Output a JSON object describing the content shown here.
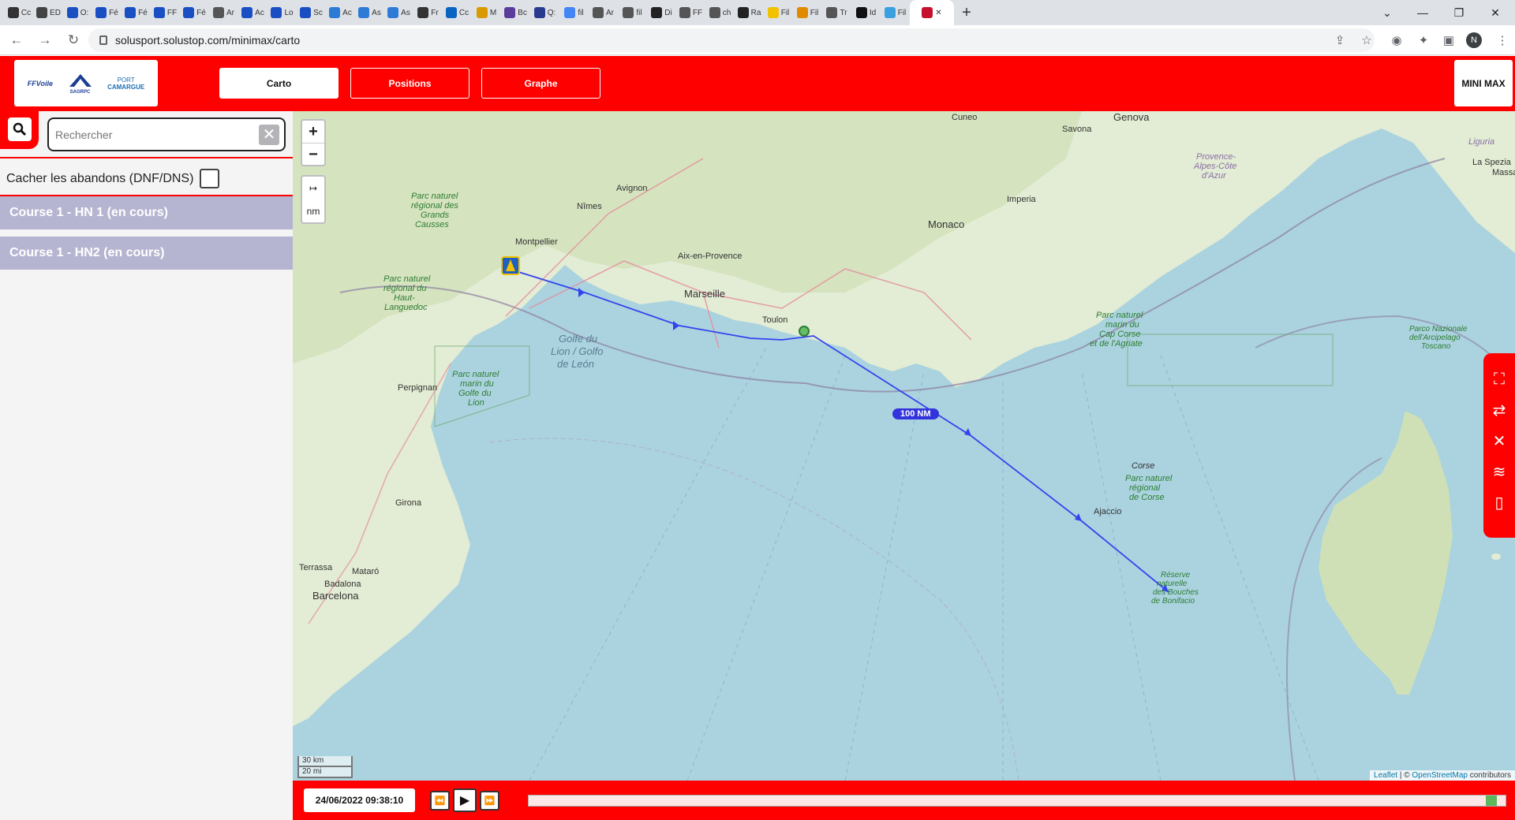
{
  "browser": {
    "tabs": [
      {
        "label": "Cc",
        "color": "#333"
      },
      {
        "label": "ED",
        "color": "#444"
      },
      {
        "label": "O:",
        "color": "#1a4fc4"
      },
      {
        "label": "Fé",
        "color": "#1a4fc4"
      },
      {
        "label": "Fé",
        "color": "#1a4fc4"
      },
      {
        "label": "FF",
        "color": "#1a4fc4"
      },
      {
        "label": "Fé",
        "color": "#1a4fc4"
      },
      {
        "label": "Ar",
        "color": "#555"
      },
      {
        "label": "Ac",
        "color": "#1a4fc4"
      },
      {
        "label": "Lo",
        "color": "#1a4fc4"
      },
      {
        "label": "Sc",
        "color": "#1a4fc4"
      },
      {
        "label": "Ac",
        "color": "#2e7bd6"
      },
      {
        "label": "As",
        "color": "#2e7bd6"
      },
      {
        "label": "As",
        "color": "#2e7bd6"
      },
      {
        "label": "Fr",
        "color": "#333"
      },
      {
        "label": "Cc",
        "color": "#0a64c2"
      },
      {
        "label": "M",
        "color": "#d99a00"
      },
      {
        "label": "Bc",
        "color": "#5a3d9b"
      },
      {
        "label": "Q:",
        "color": "#2a3b8f"
      },
      {
        "label": "fil",
        "color": "#4285f4"
      },
      {
        "label": "Ar",
        "color": "#555"
      },
      {
        "label": "fil",
        "color": "#555"
      },
      {
        "label": "Di",
        "color": "#222"
      },
      {
        "label": "FF",
        "color": "#555"
      },
      {
        "label": "ch",
        "color": "#555"
      },
      {
        "label": "Ra",
        "color": "#222"
      },
      {
        "label": "Fil",
        "color": "#f2c200"
      },
      {
        "label": "Fil",
        "color": "#e08a00"
      },
      {
        "label": "Tr",
        "color": "#555"
      },
      {
        "label": "Id",
        "color": "#111"
      },
      {
        "label": "Fil",
        "color": "#3aa0e0"
      }
    ],
    "active_tab": {
      "label": "",
      "color": "#c8102e"
    },
    "new_tab": "+",
    "url": "solusport.solustop.com/minimax/carto",
    "profile_initial": "N"
  },
  "header": {
    "logos": {
      "ffvoile": "FFVoile",
      "sagrpc": "SAGRPC",
      "port_line1": "PORT",
      "port_line2": "CAMARGUE"
    },
    "nav": [
      {
        "label": "Carto",
        "active": true
      },
      {
        "label": "Positions",
        "active": false
      },
      {
        "label": "Graphe",
        "active": false
      }
    ],
    "app_name": "MINI MAX"
  },
  "sidebar": {
    "search_placeholder": "Rechercher",
    "clear_symbol": "✕",
    "hide_abandons_label": "Cacher les abandons (DNF/DNS)",
    "courses": [
      {
        "label": "Course 1 - HN 1 (en cours)"
      },
      {
        "label": "Course 1 - HN2 (en cours)"
      }
    ]
  },
  "map": {
    "zoom_in": "+",
    "zoom_out": "−",
    "measure_icon": "↦",
    "measure_unit": "nm",
    "scale_km": "30 km",
    "scale_mi": "20 mi",
    "distance_badge": "100 NM",
    "attribution_leaflet": "Leaflet",
    "attribution_osm": "OpenStreetMap",
    "attribution_rest": " contributors",
    "labels": [
      {
        "text": "Genova"
      },
      {
        "text": "Savona"
      },
      {
        "text": "Cuneo"
      },
      {
        "text": "Imperia"
      },
      {
        "text": "Monaco"
      },
      {
        "text": "Avignon"
      },
      {
        "text": "Nîmes"
      },
      {
        "text": "Montpellier"
      },
      {
        "text": "Aix-en-Provence"
      },
      {
        "text": "Marseille"
      },
      {
        "text": "Toulon"
      },
      {
        "text": "Perpignan"
      },
      {
        "text": "Girona"
      },
      {
        "text": "Barcelona"
      },
      {
        "text": "Badalona"
      },
      {
        "text": "Mataró"
      },
      {
        "text": "Terrassa"
      },
      {
        "text": "Ajaccio"
      },
      {
        "text": "Corse"
      },
      {
        "text": "Golfe du"
      },
      {
        "text": "Lion / Golfo"
      },
      {
        "text": "de León"
      },
      {
        "text": "La Spezia"
      },
      {
        "text": "Massa"
      },
      {
        "text": "Liguria"
      },
      {
        "text": "Parc naturel"
      },
      {
        "text": "marin du"
      },
      {
        "text": "Golfe du"
      },
      {
        "text": "Lion"
      },
      {
        "text": "Parc naturel"
      },
      {
        "text": "marin du"
      },
      {
        "text": "Cap Corse"
      },
      {
        "text": "et de l'Agriate"
      },
      {
        "text": "Parc naturel"
      },
      {
        "text": "régional"
      },
      {
        "text": "de Corse"
      },
      {
        "text": "Parc naturel"
      },
      {
        "text": "régional des"
      },
      {
        "text": "Grands"
      },
      {
        "text": "Causses"
      },
      {
        "text": "Parc naturel"
      },
      {
        "text": "régional du"
      },
      {
        "text": "Haut-"
      },
      {
        "text": "Languedoc"
      },
      {
        "text": "Provence-"
      },
      {
        "text": "Alpes-Côte"
      },
      {
        "text": "d'Azur"
      },
      {
        "text": "Parco Nazionale"
      },
      {
        "text": "dell'Arcipelago"
      },
      {
        "text": "Toscano"
      },
      {
        "text": "Réserve"
      },
      {
        "text": "naturelle"
      },
      {
        "text": "des Bouches"
      },
      {
        "text": "de Bonifacio"
      }
    ]
  },
  "timeline": {
    "datetime": "24/06/2022 09:38:10",
    "rewind": "⏪",
    "play": "▶",
    "forward": "⏩",
    "progress": 0.99
  },
  "colors": {
    "brand_red": "#ff0000",
    "course_bg": "#b5b5d1",
    "track_blue": "#3344ee",
    "sea": "#aad3df",
    "land": "#e8eedc"
  }
}
